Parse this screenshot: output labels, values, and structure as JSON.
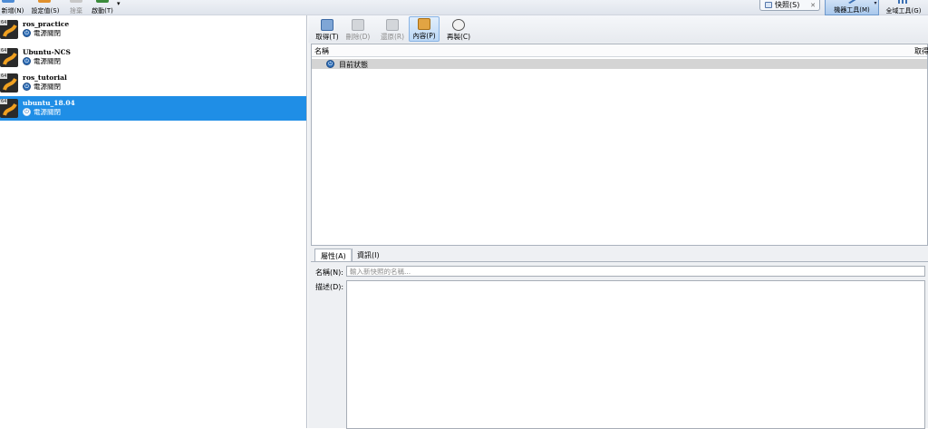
{
  "toolbar": {
    "new_label": "新增(N)",
    "settings_label": "設定值(S)",
    "discard_label": "捨棄",
    "start_label": "啟動(T)",
    "snapshots_label": "快照(S)",
    "machine_tools_label": "機器工具(M)",
    "global_tools_label": "全域工具(G)"
  },
  "vms": [
    {
      "name": "ros_practice",
      "state": "電源關閉",
      "arch": "64"
    },
    {
      "name": "Ubuntu-NCS",
      "state": "電源關閉",
      "arch": "64"
    },
    {
      "name": "ros_tutorial",
      "state": "電源關閉",
      "arch": "64"
    },
    {
      "name": "ubuntu_18.04",
      "state": "電源關閉",
      "arch": "64",
      "selected": true
    }
  ],
  "snapshot_toolbar": {
    "take_label": "取得(T)",
    "delete_label": "刪除(D)",
    "restore_label": "還原(R)",
    "properties_label": "內容(P)",
    "clone_label": "再製(C)"
  },
  "snapshot_tree": {
    "col_name": "名稱",
    "col_taken": "取得",
    "current_state": "目前狀態"
  },
  "details": {
    "tab_attributes": "屬性(A)",
    "tab_information": "資訊(I)",
    "name_label": "名稱(N):",
    "name_placeholder": "輸入新快照的名稱...",
    "desc_label": "描述(D):"
  },
  "colors": {
    "selection": "#1f8ee6",
    "accent_blue": "#2f6fb8",
    "toolbar_bg": "#e7eaef"
  }
}
